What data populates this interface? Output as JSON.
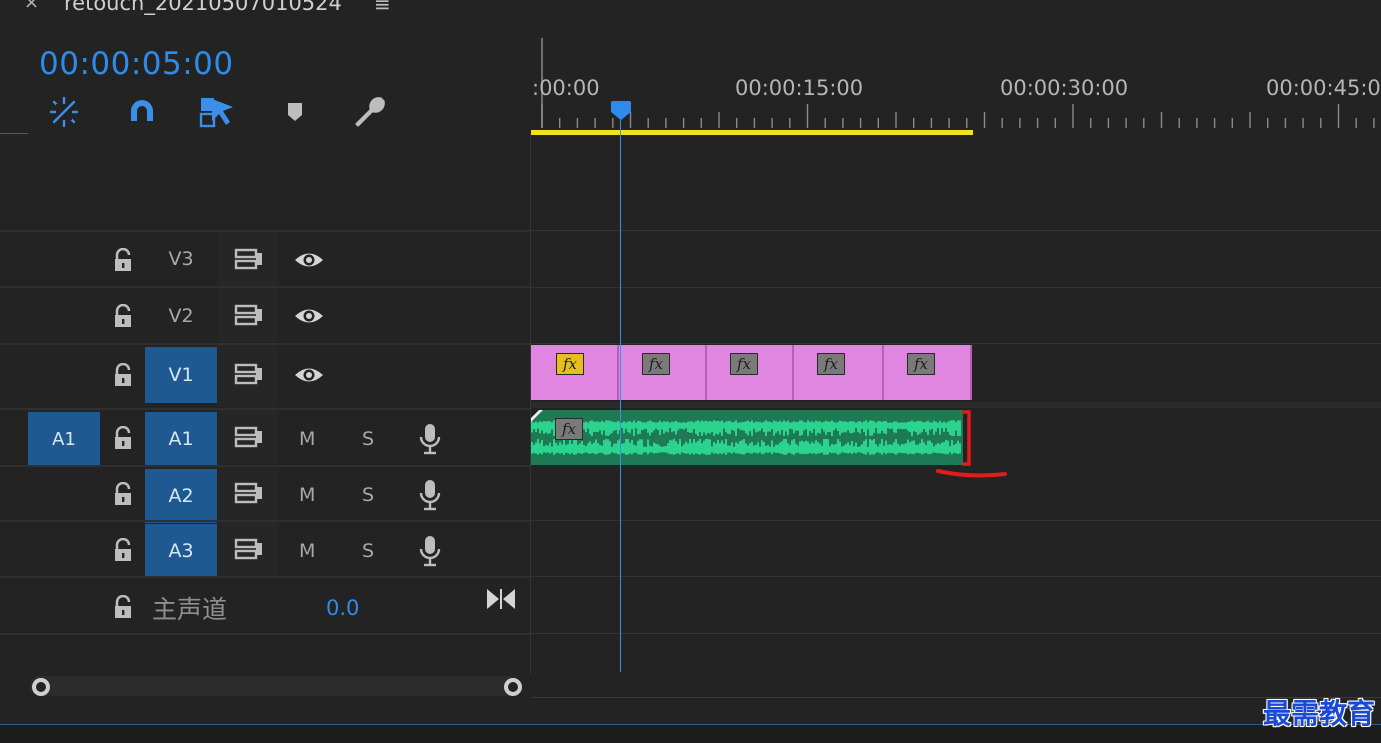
{
  "header": {
    "close_glyph": "×",
    "sequence_title": "retouch_20210507010524",
    "menu_glyph": "≡",
    "timecode": "00:00:05:00"
  },
  "toolbar": {
    "tools": [
      "nest-sequence-icon",
      "snap-magnet-icon",
      "linked-selection-icon",
      "add-marker-icon",
      "settings-wrench-icon"
    ]
  },
  "ruler": {
    "labels": [
      ":00:00",
      "00:00:15:00",
      "00:00:30:00",
      "00:00:45:0"
    ]
  },
  "tracks": {
    "video": [
      {
        "name": "V3",
        "targeted": false
      },
      {
        "name": "V2",
        "targeted": false
      },
      {
        "name": "V1",
        "targeted": true
      }
    ],
    "audio": [
      {
        "source": "A1",
        "name": "A1",
        "mute": "M",
        "solo": "S"
      },
      {
        "name": "A2",
        "mute": "M",
        "solo": "S"
      },
      {
        "name": "A3",
        "mute": "M",
        "solo": "S"
      }
    ],
    "master": {
      "label": "主声道",
      "value": "0.0"
    }
  },
  "clips": {
    "fx_label": "fx"
  },
  "colors": {
    "accent": "#2d8ceb",
    "video_clip": "#e085e0",
    "audio_clip": "#2bd38f",
    "work_area": "#f0e31b",
    "target": "#1e5a91"
  },
  "watermark": "最需教育"
}
